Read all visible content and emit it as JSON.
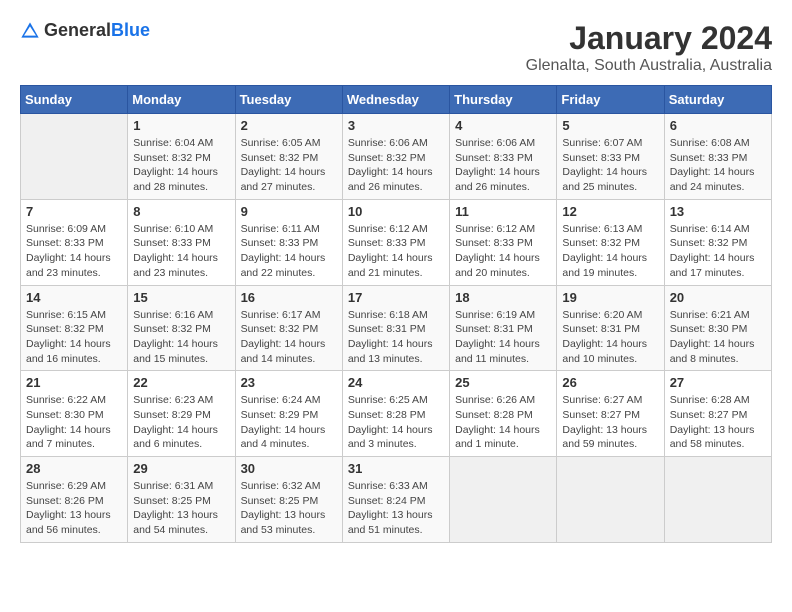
{
  "header": {
    "logo_general": "General",
    "logo_blue": "Blue",
    "title": "January 2024",
    "subtitle": "Glenalta, South Australia, Australia"
  },
  "calendar": {
    "days_of_week": [
      "Sunday",
      "Monday",
      "Tuesday",
      "Wednesday",
      "Thursday",
      "Friday",
      "Saturday"
    ],
    "weeks": [
      [
        {
          "date": "",
          "sunrise": "",
          "sunset": "",
          "daylight": "",
          "empty": true
        },
        {
          "date": "1",
          "sunrise": "Sunrise: 6:04 AM",
          "sunset": "Sunset: 8:32 PM",
          "daylight": "Daylight: 14 hours and 28 minutes."
        },
        {
          "date": "2",
          "sunrise": "Sunrise: 6:05 AM",
          "sunset": "Sunset: 8:32 PM",
          "daylight": "Daylight: 14 hours and 27 minutes."
        },
        {
          "date": "3",
          "sunrise": "Sunrise: 6:06 AM",
          "sunset": "Sunset: 8:32 PM",
          "daylight": "Daylight: 14 hours and 26 minutes."
        },
        {
          "date": "4",
          "sunrise": "Sunrise: 6:06 AM",
          "sunset": "Sunset: 8:33 PM",
          "daylight": "Daylight: 14 hours and 26 minutes."
        },
        {
          "date": "5",
          "sunrise": "Sunrise: 6:07 AM",
          "sunset": "Sunset: 8:33 PM",
          "daylight": "Daylight: 14 hours and 25 minutes."
        },
        {
          "date": "6",
          "sunrise": "Sunrise: 6:08 AM",
          "sunset": "Sunset: 8:33 PM",
          "daylight": "Daylight: 14 hours and 24 minutes."
        }
      ],
      [
        {
          "date": "7",
          "sunrise": "Sunrise: 6:09 AM",
          "sunset": "Sunset: 8:33 PM",
          "daylight": "Daylight: 14 hours and 23 minutes."
        },
        {
          "date": "8",
          "sunrise": "Sunrise: 6:10 AM",
          "sunset": "Sunset: 8:33 PM",
          "daylight": "Daylight: 14 hours and 23 minutes."
        },
        {
          "date": "9",
          "sunrise": "Sunrise: 6:11 AM",
          "sunset": "Sunset: 8:33 PM",
          "daylight": "Daylight: 14 hours and 22 minutes."
        },
        {
          "date": "10",
          "sunrise": "Sunrise: 6:12 AM",
          "sunset": "Sunset: 8:33 PM",
          "daylight": "Daylight: 14 hours and 21 minutes."
        },
        {
          "date": "11",
          "sunrise": "Sunrise: 6:12 AM",
          "sunset": "Sunset: 8:33 PM",
          "daylight": "Daylight: 14 hours and 20 minutes."
        },
        {
          "date": "12",
          "sunrise": "Sunrise: 6:13 AM",
          "sunset": "Sunset: 8:32 PM",
          "daylight": "Daylight: 14 hours and 19 minutes."
        },
        {
          "date": "13",
          "sunrise": "Sunrise: 6:14 AM",
          "sunset": "Sunset: 8:32 PM",
          "daylight": "Daylight: 14 hours and 17 minutes."
        }
      ],
      [
        {
          "date": "14",
          "sunrise": "Sunrise: 6:15 AM",
          "sunset": "Sunset: 8:32 PM",
          "daylight": "Daylight: 14 hours and 16 minutes."
        },
        {
          "date": "15",
          "sunrise": "Sunrise: 6:16 AM",
          "sunset": "Sunset: 8:32 PM",
          "daylight": "Daylight: 14 hours and 15 minutes."
        },
        {
          "date": "16",
          "sunrise": "Sunrise: 6:17 AM",
          "sunset": "Sunset: 8:32 PM",
          "daylight": "Daylight: 14 hours and 14 minutes."
        },
        {
          "date": "17",
          "sunrise": "Sunrise: 6:18 AM",
          "sunset": "Sunset: 8:31 PM",
          "daylight": "Daylight: 14 hours and 13 minutes."
        },
        {
          "date": "18",
          "sunrise": "Sunrise: 6:19 AM",
          "sunset": "Sunset: 8:31 PM",
          "daylight": "Daylight: 14 hours and 11 minutes."
        },
        {
          "date": "19",
          "sunrise": "Sunrise: 6:20 AM",
          "sunset": "Sunset: 8:31 PM",
          "daylight": "Daylight: 14 hours and 10 minutes."
        },
        {
          "date": "20",
          "sunrise": "Sunrise: 6:21 AM",
          "sunset": "Sunset: 8:30 PM",
          "daylight": "Daylight: 14 hours and 8 minutes."
        }
      ],
      [
        {
          "date": "21",
          "sunrise": "Sunrise: 6:22 AM",
          "sunset": "Sunset: 8:30 PM",
          "daylight": "Daylight: 14 hours and 7 minutes."
        },
        {
          "date": "22",
          "sunrise": "Sunrise: 6:23 AM",
          "sunset": "Sunset: 8:29 PM",
          "daylight": "Daylight: 14 hours and 6 minutes."
        },
        {
          "date": "23",
          "sunrise": "Sunrise: 6:24 AM",
          "sunset": "Sunset: 8:29 PM",
          "daylight": "Daylight: 14 hours and 4 minutes."
        },
        {
          "date": "24",
          "sunrise": "Sunrise: 6:25 AM",
          "sunset": "Sunset: 8:28 PM",
          "daylight": "Daylight: 14 hours and 3 minutes."
        },
        {
          "date": "25",
          "sunrise": "Sunrise: 6:26 AM",
          "sunset": "Sunset: 8:28 PM",
          "daylight": "Daylight: 14 hours and 1 minute."
        },
        {
          "date": "26",
          "sunrise": "Sunrise: 6:27 AM",
          "sunset": "Sunset: 8:27 PM",
          "daylight": "Daylight: 13 hours and 59 minutes."
        },
        {
          "date": "27",
          "sunrise": "Sunrise: 6:28 AM",
          "sunset": "Sunset: 8:27 PM",
          "daylight": "Daylight: 13 hours and 58 minutes."
        }
      ],
      [
        {
          "date": "28",
          "sunrise": "Sunrise: 6:29 AM",
          "sunset": "Sunset: 8:26 PM",
          "daylight": "Daylight: 13 hours and 56 minutes."
        },
        {
          "date": "29",
          "sunrise": "Sunrise: 6:31 AM",
          "sunset": "Sunset: 8:25 PM",
          "daylight": "Daylight: 13 hours and 54 minutes."
        },
        {
          "date": "30",
          "sunrise": "Sunrise: 6:32 AM",
          "sunset": "Sunset: 8:25 PM",
          "daylight": "Daylight: 13 hours and 53 minutes."
        },
        {
          "date": "31",
          "sunrise": "Sunrise: 6:33 AM",
          "sunset": "Sunset: 8:24 PM",
          "daylight": "Daylight: 13 hours and 51 minutes."
        },
        {
          "date": "",
          "sunrise": "",
          "sunset": "",
          "daylight": "",
          "empty": true
        },
        {
          "date": "",
          "sunrise": "",
          "sunset": "",
          "daylight": "",
          "empty": true
        },
        {
          "date": "",
          "sunrise": "",
          "sunset": "",
          "daylight": "",
          "empty": true
        }
      ]
    ]
  }
}
